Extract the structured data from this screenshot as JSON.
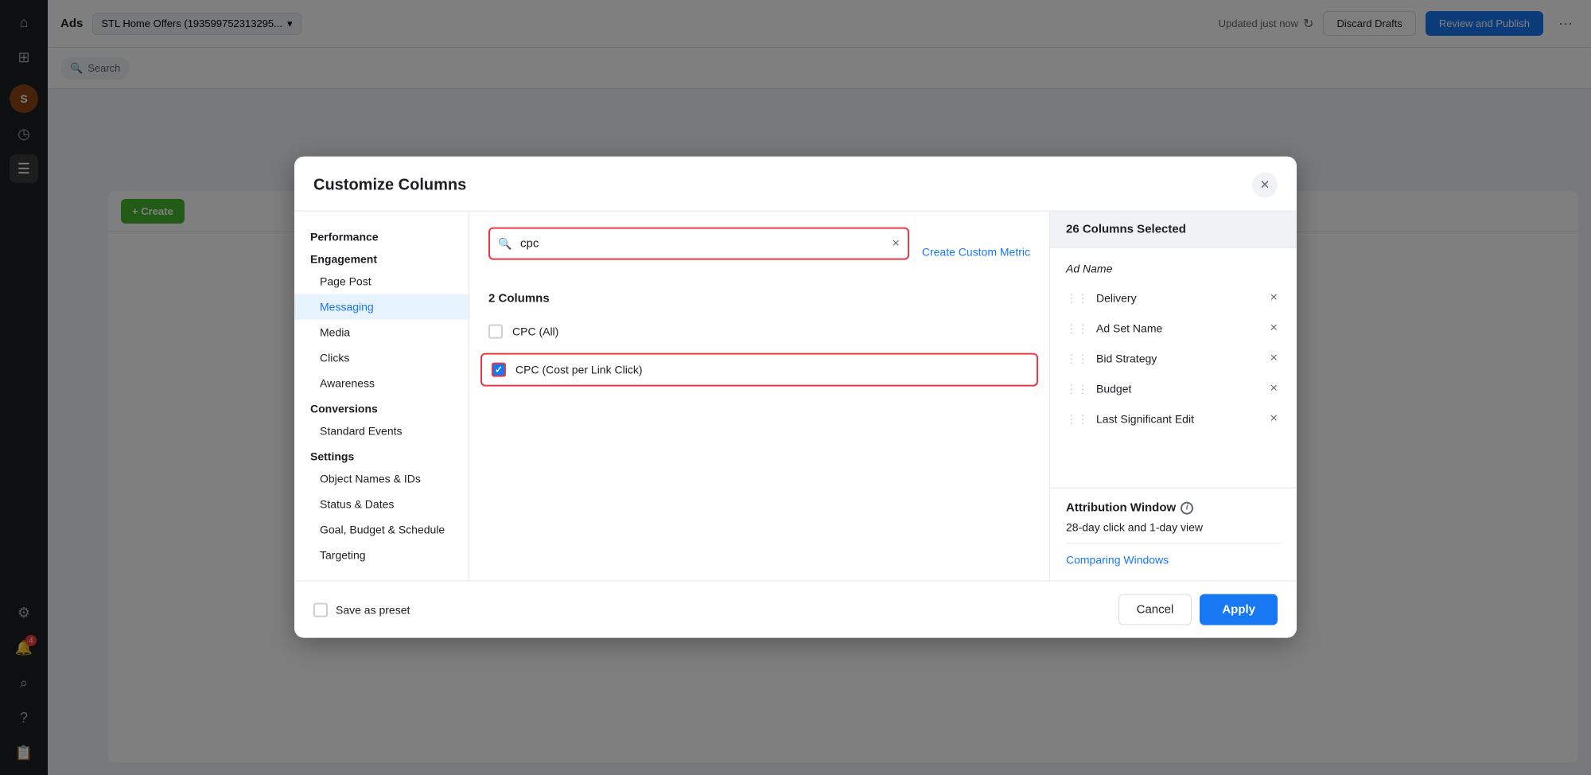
{
  "app": {
    "title": "Ads",
    "account_name": "STL Home Offers (193599752313295...",
    "updated_status": "Updated just now",
    "discard_drafts_label": "Discard Drafts",
    "review_publish_label": "Review and Publish"
  },
  "sidebar": {
    "icons": [
      {
        "name": "home-icon",
        "symbol": "⌂",
        "active": false
      },
      {
        "name": "grid-icon",
        "symbol": "⊞",
        "active": false
      },
      {
        "name": "image-icon",
        "symbol": "🖼",
        "active": false
      },
      {
        "name": "clock-icon",
        "symbol": "◷",
        "active": false
      },
      {
        "name": "list-icon",
        "symbol": "☰",
        "active": true
      },
      {
        "name": "gear-icon",
        "symbol": "⚙",
        "active": false
      },
      {
        "name": "bell-icon",
        "symbol": "🔔",
        "active": false,
        "badge": "4"
      },
      {
        "name": "search-icon-sidebar",
        "symbol": "⌕",
        "active": false
      },
      {
        "name": "question-icon",
        "symbol": "?",
        "active": false
      },
      {
        "name": "book-icon",
        "symbol": "📋",
        "active": false
      }
    ]
  },
  "modal": {
    "title": "Customize Columns",
    "close_label": "×",
    "search_placeholder": "cpc",
    "search_value": "cpc",
    "create_custom_metric_label": "Create Custom Metric",
    "columns_count_label": "2 Columns",
    "sidebar_sections": [
      {
        "title": "Performance",
        "items": []
      },
      {
        "title": "Engagement",
        "items": [
          "Page Post",
          "Messaging",
          "Media",
          "Clicks",
          "Awareness"
        ]
      },
      {
        "title": "Conversions",
        "items": [
          "Standard Events"
        ]
      },
      {
        "title": "Settings",
        "items": [
          "Object Names & IDs",
          "Status & Dates",
          "Goal, Budget & Schedule",
          "Targeting"
        ]
      }
    ],
    "active_sidebar_item": "Messaging",
    "checkboxes": [
      {
        "id": "cpc-all",
        "label": "CPC (All)",
        "checked": false,
        "highlighted": false
      },
      {
        "id": "cpc-cost-per-link-click",
        "label": "CPC (Cost per Link Click)",
        "checked": true,
        "highlighted": true
      }
    ],
    "selected_columns": {
      "header": "26 Columns Selected",
      "fixed_item": "Ad Name",
      "items": [
        {
          "name": "Delivery",
          "removable": true
        },
        {
          "name": "Ad Set Name",
          "removable": true
        },
        {
          "name": "Bid Strategy",
          "removable": true
        },
        {
          "name": "Budget",
          "removable": true
        },
        {
          "name": "Last Significant Edit",
          "removable": true
        }
      ]
    },
    "attribution": {
      "title": "Attribution Window",
      "value": "28-day click and 1-day view",
      "comparing_windows_label": "Comparing Windows"
    },
    "footer": {
      "save_preset_label": "Save as preset",
      "cancel_label": "Cancel",
      "apply_label": "Apply"
    }
  },
  "background_table": {
    "create_button_label": "+ Create",
    "search_placeholder": "Search"
  }
}
